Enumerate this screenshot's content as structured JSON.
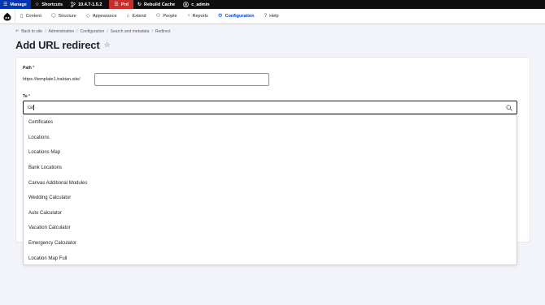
{
  "toolbar": {
    "manage_label": "Manage",
    "shortcuts_label": "Shortcuts",
    "version_label": "10.4.7-1.5.2",
    "env_label": "Prd",
    "rebuild_label": "Rebuild Cache",
    "user_label": "c_admin"
  },
  "tray": {
    "items": [
      {
        "label": "Content",
        "icon": "content-icon"
      },
      {
        "label": "Structure",
        "icon": "structure-icon"
      },
      {
        "label": "Appearance",
        "icon": "appearance-icon"
      },
      {
        "label": "Extend",
        "icon": "extend-icon"
      },
      {
        "label": "People",
        "icon": "people-icon"
      },
      {
        "label": "Reports",
        "icon": "reports-icon"
      },
      {
        "label": "Configuration",
        "icon": "configuration-icon",
        "active": true
      },
      {
        "label": "Help",
        "icon": "help-icon"
      }
    ]
  },
  "breadcrumb": {
    "back": "Back to site",
    "items": [
      "Administration",
      "Configuration",
      "Search and metadata",
      "Redirect"
    ],
    "separator": "/"
  },
  "page": {
    "title": "Add URL redirect"
  },
  "form": {
    "path_label": "Path",
    "path_prefix": "https://template1.trabian.site/",
    "path_value": "",
    "to_label": "To",
    "to_value": "ca",
    "required_marker": "*"
  },
  "autocomplete": {
    "options": [
      "Certificates",
      "Locations",
      "Locations Map",
      "Bank Locations",
      "Canvas Additional Modules",
      "Wedding Calculator",
      "Auto Calculator",
      "Vacation Calculator",
      "Emergency Calculator",
      "Location Map Full"
    ]
  },
  "colors": {
    "toolbar_bg": "#0f0f0f",
    "manage_bg": "#0036b1",
    "env_bg": "#c62d2d",
    "active": "#003ecc",
    "required": "#dc2323"
  }
}
